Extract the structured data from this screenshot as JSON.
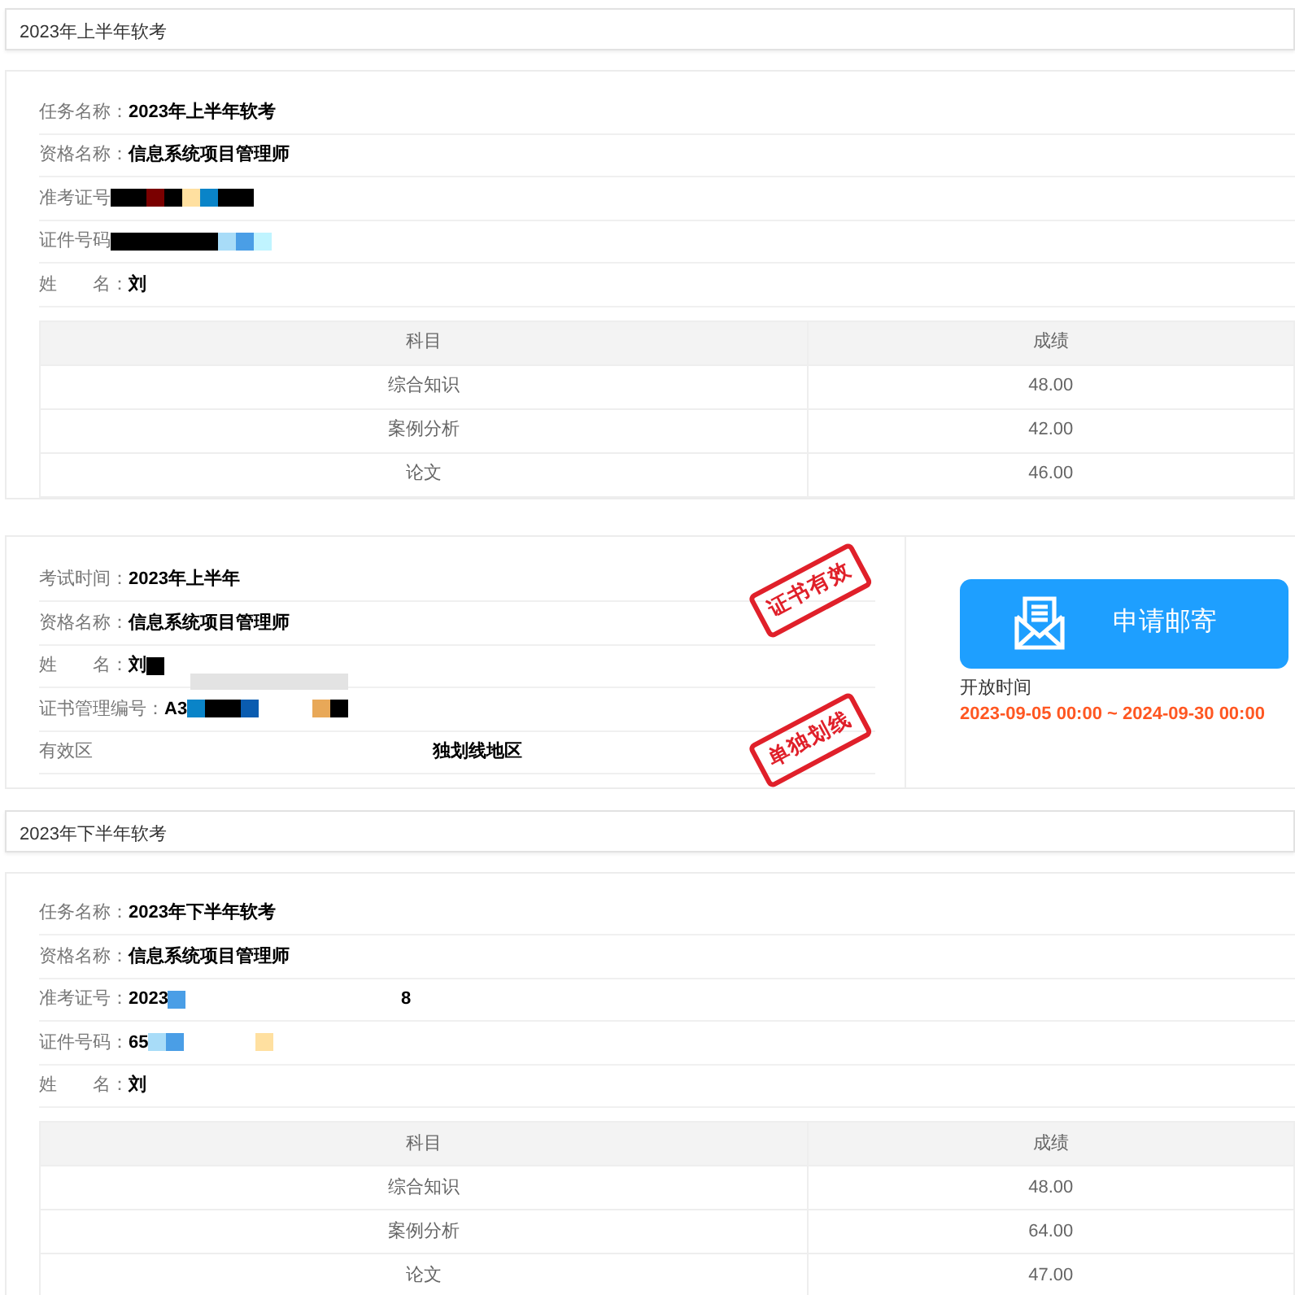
{
  "sections": [
    {
      "kind": "exam",
      "header": "2023年上半年软考",
      "fields": [
        {
          "label": "任务名称：",
          "parts": [
            {
              "kind": "text",
              "text": "2023年上半年软考"
            }
          ]
        },
        {
          "label": "资格名称：",
          "parts": [
            {
              "kind": "text",
              "text": "信息系统项目管理师"
            }
          ]
        },
        {
          "label": "准考证号",
          "parts": [
            {
              "kind": "block",
              "color": "#000000"
            },
            {
              "kind": "block",
              "color": "#000000"
            },
            {
              "kind": "block",
              "color": "#7a0000"
            },
            {
              "kind": "block",
              "color": "#000000"
            },
            {
              "kind": "block",
              "color": "#ffe0a0"
            },
            {
              "kind": "block",
              "color": "#0a84c8"
            },
            {
              "kind": "block",
              "color": "#000000"
            },
            {
              "kind": "block",
              "color": "#000000"
            }
          ]
        },
        {
          "label": "证件号码",
          "parts": [
            {
              "kind": "block",
              "color": "#000000"
            },
            {
              "kind": "block",
              "color": "#000000"
            },
            {
              "kind": "block",
              "color": "#000000"
            },
            {
              "kind": "block",
              "color": "#000000"
            },
            {
              "kind": "block",
              "color": "#000000"
            },
            {
              "kind": "block",
              "color": "#000000"
            },
            {
              "kind": "block",
              "color": "#a8dcf8"
            },
            {
              "kind": "block",
              "color": "#4a9ee6"
            },
            {
              "kind": "block",
              "color": "#c0f4ff"
            }
          ]
        },
        {
          "label": "姓　　名：",
          "parts": [
            {
              "kind": "text",
              "text": "刘"
            }
          ]
        }
      ],
      "table": {
        "columns": [
          "科目",
          "成绩"
        ],
        "rows": [
          [
            "综合知识",
            "48.00"
          ],
          [
            "案例分析",
            "42.00"
          ],
          [
            "论文",
            "46.00"
          ]
        ]
      }
    },
    {
      "kind": "certificate",
      "fields": [
        {
          "label": "考试时间：",
          "parts": [
            {
              "kind": "text",
              "text": "2023年上半年"
            }
          ]
        },
        {
          "label": "资格名称：",
          "parts": [
            {
              "kind": "text",
              "text": "信息系统项目管理师"
            }
          ]
        },
        {
          "label": "姓　　名：",
          "parts": [
            {
              "kind": "text",
              "text": "刘"
            },
            {
              "kind": "block",
              "color": "#000000"
            }
          ]
        },
        {
          "label": "证书管理编号：",
          "parts": [
            {
              "kind": "cover",
              "color": "#e3e3e3"
            },
            {
              "kind": "text",
              "text": "A3"
            },
            {
              "kind": "block",
              "color": "#0a84c8"
            },
            {
              "kind": "block",
              "color": "#000000"
            },
            {
              "kind": "block",
              "color": "#000000"
            },
            {
              "kind": "block",
              "color": "#0a5cb0"
            },
            {
              "kind": "gap"
            },
            {
              "kind": "gap"
            },
            {
              "kind": "gap"
            },
            {
              "kind": "block",
              "color": "#e8a858"
            },
            {
              "kind": "block",
              "color": "#000000"
            }
          ]
        },
        {
          "label": "有效区",
          "parts": [
            {
              "kind": "gap"
            },
            {
              "kind": "gap"
            },
            {
              "kind": "gap"
            },
            {
              "kind": "gap"
            },
            {
              "kind": "gap"
            },
            {
              "kind": "gap"
            },
            {
              "kind": "gap"
            },
            {
              "kind": "gap"
            },
            {
              "kind": "gap"
            },
            {
              "kind": "gap"
            },
            {
              "kind": "gap"
            },
            {
              "kind": "gap"
            },
            {
              "kind": "gap"
            },
            {
              "kind": "gap"
            },
            {
              "kind": "gap"
            },
            {
              "kind": "gap"
            },
            {
              "kind": "gap"
            },
            {
              "kind": "gap"
            },
            {
              "kind": "gap"
            },
            {
              "kind": "text",
              "text": "独划线地区"
            }
          ]
        }
      ],
      "stamps": [
        {
          "text": "证书有效"
        },
        {
          "text": "单独划线"
        }
      ],
      "action": {
        "button": "申请邮寄",
        "open_label": "开放时间",
        "open_range": "2023-09-05 00:00 ~ 2024-09-30 00:00"
      }
    },
    {
      "kind": "exam",
      "header": "2023年下半年软考",
      "fields": [
        {
          "label": "任务名称：",
          "parts": [
            {
              "kind": "text",
              "text": "2023年下半年软考"
            }
          ]
        },
        {
          "label": "资格名称：",
          "parts": [
            {
              "kind": "text",
              "text": "信息系统项目管理师"
            }
          ]
        },
        {
          "label": "准考证号：",
          "parts": [
            {
              "kind": "text",
              "text": "2023"
            },
            {
              "kind": "block",
              "color": "#4a9ee6"
            },
            {
              "kind": "gap"
            },
            {
              "kind": "gap"
            },
            {
              "kind": "gap"
            },
            {
              "kind": "gap"
            },
            {
              "kind": "gap"
            },
            {
              "kind": "gap"
            },
            {
              "kind": "gap"
            },
            {
              "kind": "gap"
            },
            {
              "kind": "gap"
            },
            {
              "kind": "gap"
            },
            {
              "kind": "gap"
            },
            {
              "kind": "gap"
            },
            {
              "kind": "text",
              "text": "8"
            }
          ]
        },
        {
          "label": "证件号码：",
          "parts": [
            {
              "kind": "text",
              "text": "65"
            },
            {
              "kind": "block",
              "color": "#a8dcf8"
            },
            {
              "kind": "block",
              "color": "#4a9ee6"
            },
            {
              "kind": "gap"
            },
            {
              "kind": "gap"
            },
            {
              "kind": "gap"
            },
            {
              "kind": "gap"
            },
            {
              "kind": "block",
              "color": "#ffe0a0"
            }
          ]
        },
        {
          "label": "姓　　名：",
          "parts": [
            {
              "kind": "text",
              "text": "刘"
            }
          ]
        }
      ],
      "table": {
        "columns": [
          "科目",
          "成绩"
        ],
        "rows": [
          [
            "综合知识",
            "48.00"
          ],
          [
            "案例分析",
            "64.00"
          ],
          [
            "论文",
            "47.00"
          ]
        ]
      }
    }
  ]
}
